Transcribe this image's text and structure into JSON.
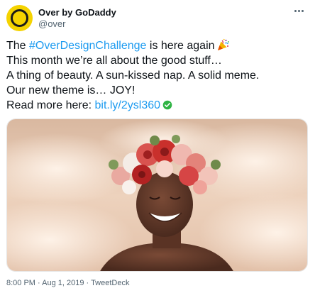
{
  "author": {
    "name": "Over by GoDaddy",
    "handle": "@over",
    "avatar_colors": {
      "background": "#f5d300",
      "ring": "#1a1a1a"
    }
  },
  "tweet": {
    "line1_before": "The ",
    "hashtag": "#OverDesignChallenge",
    "line1_after": " is here again",
    "line1_emoji": "party-popper-icon",
    "line2": "This month we’re all about the good stuff…",
    "line3": "A thing of beauty. A sun-kissed nap. A solid meme.",
    "line4": "Our new theme is… JOY!",
    "line5_before": "Read more here: ",
    "link": "bit.ly/2ysl360",
    "link_emoji": "check-mark-button-icon"
  },
  "media": {
    "subject": "smiling-woman-with-flower-crown-photo"
  },
  "meta": {
    "time": "8:00 PM",
    "separator1": " · ",
    "date": "Aug 1, 2019",
    "separator2": " · ",
    "source": "TweetDeck"
  },
  "colors": {
    "link": "#1d9bf0",
    "secondary_text": "#536471",
    "primary_text": "#0f1419",
    "check_green": "#2fb344"
  }
}
